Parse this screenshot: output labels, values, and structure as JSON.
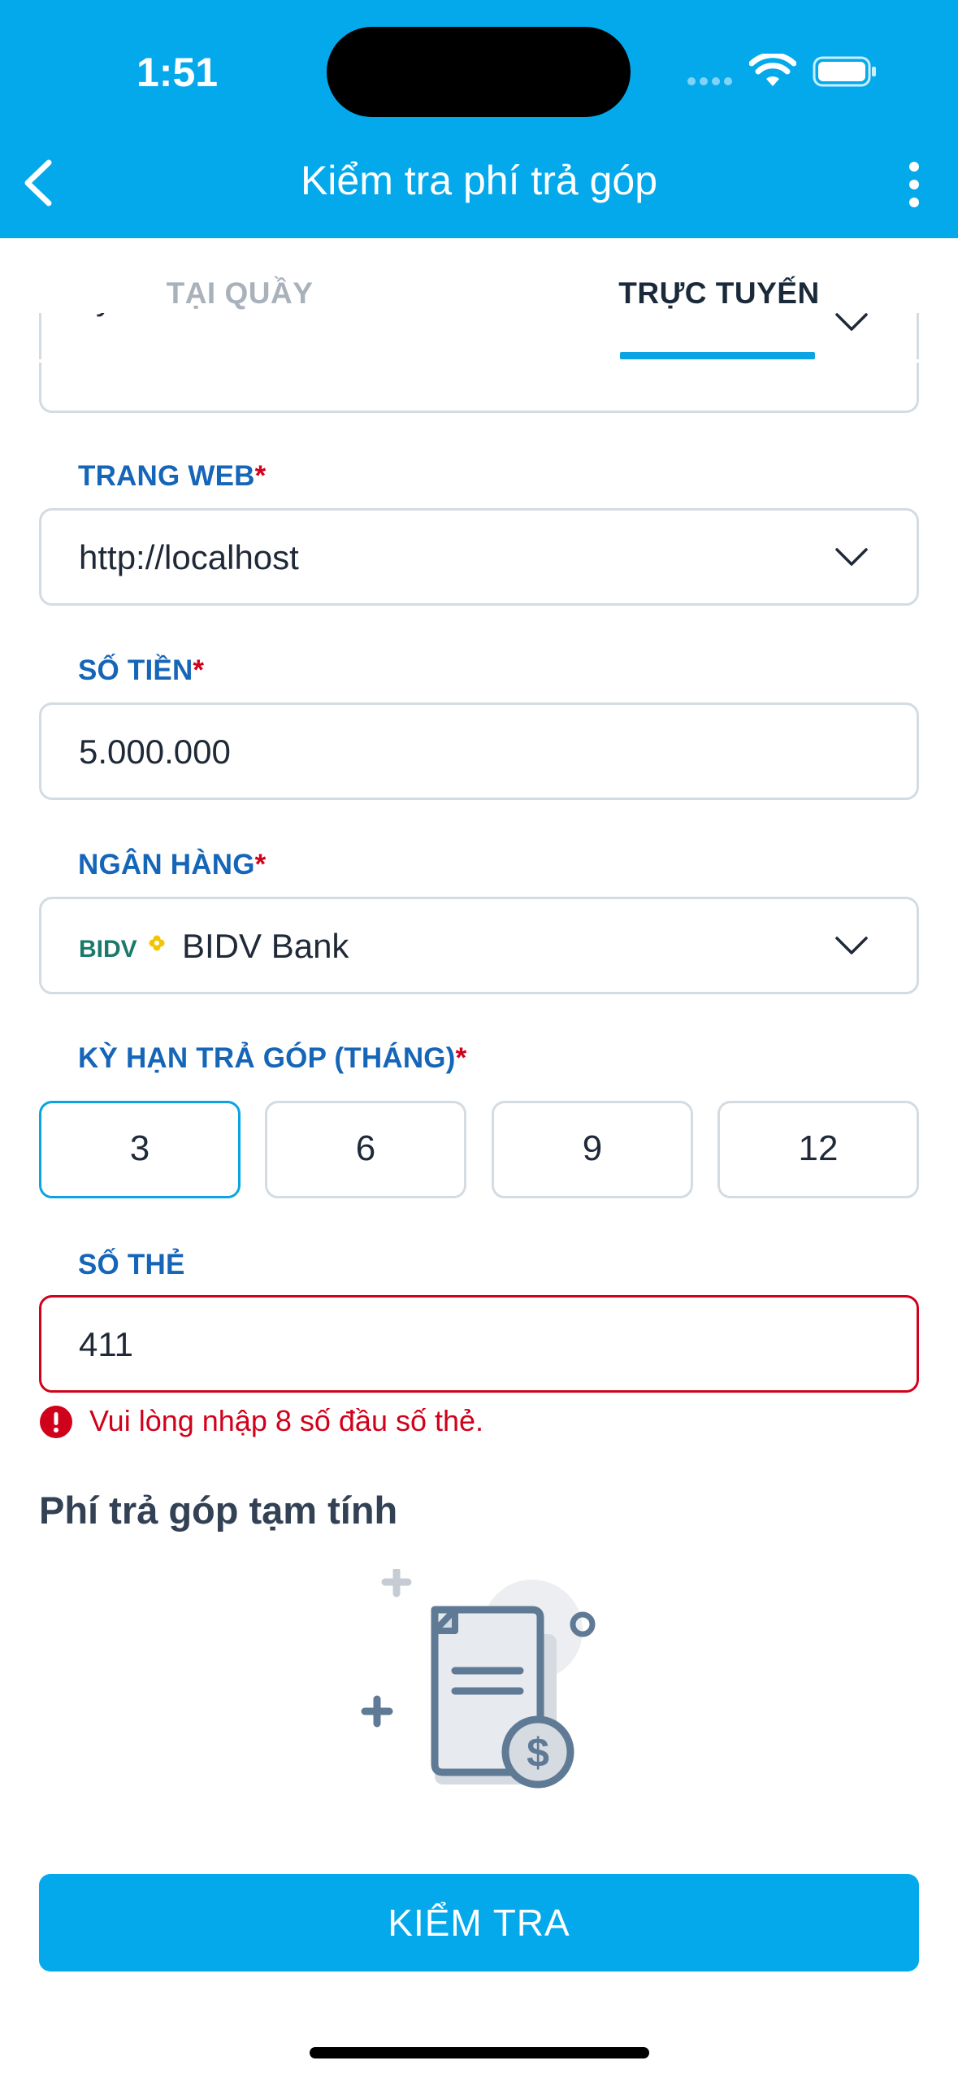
{
  "status_bar": {
    "time": "1:51"
  },
  "header": {
    "title": "Kiểm tra phí trả góp"
  },
  "tabs": [
    {
      "label": "TẠI QUẦY"
    },
    {
      "label": "TRỰC TUYẾN"
    }
  ],
  "form": {
    "partial_field_value": "kymdan",
    "website": {
      "label": "TRANG WEB",
      "required_mark": "*",
      "value": "http://localhost"
    },
    "amount": {
      "label": "SỐ TIỀN",
      "required_mark": "*",
      "value": "5.000.000"
    },
    "bank": {
      "label": "NGÂN HÀNG",
      "required_mark": "*",
      "logo_text": "BIDV",
      "value": "BIDV Bank"
    },
    "term": {
      "label": "KỲ HẠN TRẢ GÓP (THÁNG)",
      "required_mark": "*",
      "options": [
        "3",
        "6",
        "9",
        "12"
      ],
      "selected": "3"
    },
    "card": {
      "label": "SỐ THẺ",
      "value": "411",
      "error": "Vui lòng nhập 8 số đầu số thẻ."
    }
  },
  "result": {
    "title": "Phí trả góp tạm tính"
  },
  "actions": {
    "check_label": "KIỂM TRA"
  },
  "colors": {
    "primary": "#04a9ec",
    "label": "#1565b8",
    "error": "#d0021b",
    "bidv_green": "#1a7a6a"
  }
}
